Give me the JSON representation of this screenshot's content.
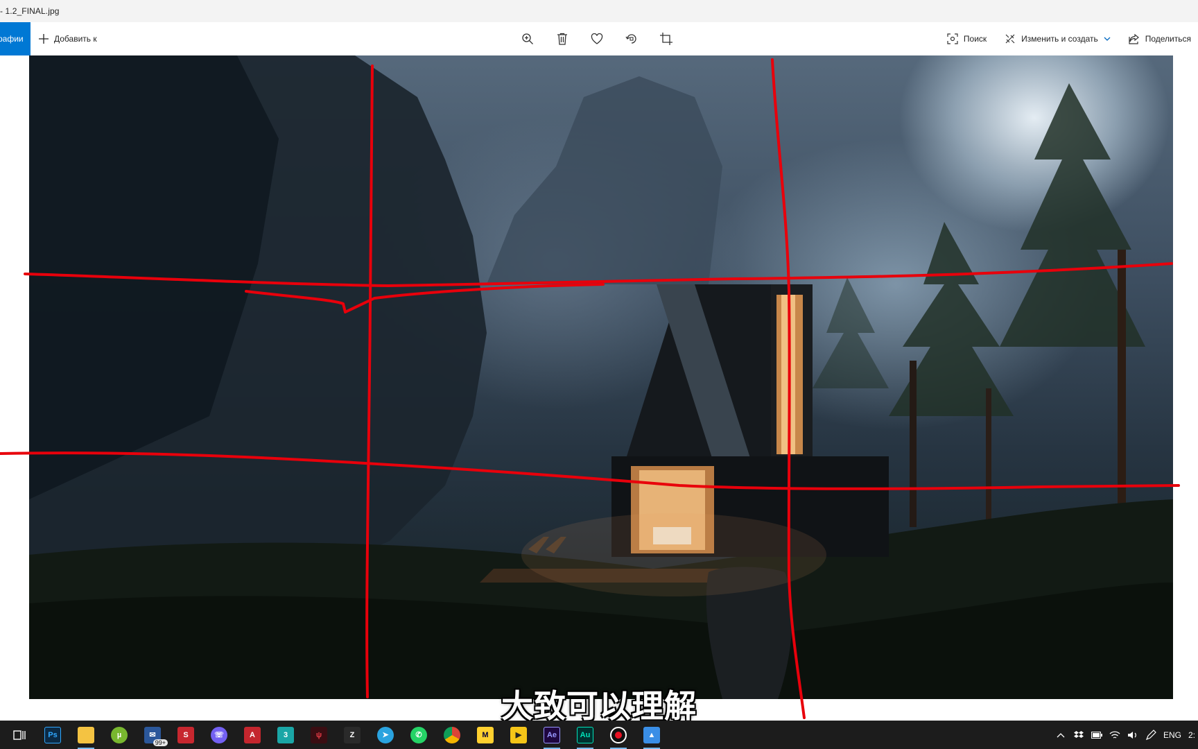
{
  "window": {
    "title": "- 1.2_FINAL.jpg"
  },
  "toolbar": {
    "tab_label": "рафии",
    "add_label": "Добавить к",
    "search_label": "Поиск",
    "edit_label": "Изменить и создать",
    "share_label": "Поделиться"
  },
  "subtitle": "大致可以理解",
  "taskbar": {
    "mail_badge": "99+",
    "lang": "ENG",
    "clock_partial": "2:"
  },
  "icons": {
    "toolbar": [
      "plus-icon",
      "zoom-in-icon",
      "delete-icon",
      "favorite-icon",
      "rotate-icon",
      "crop-icon",
      "search-icon",
      "edit-create-icon",
      "chevron-down-icon",
      "share-icon"
    ],
    "taskbar": [
      "task-view-icon",
      "photoshop-icon",
      "file-explorer-icon",
      "utorrent-icon",
      "mail-icon",
      "sketchup-icon",
      "viber-icon",
      "autocad-icon",
      "3dsmax-icon",
      "predator-icon",
      "zbrush-icon",
      "telegram-icon",
      "whatsapp-icon",
      "chrome-icon",
      "miro-icon",
      "media-player-icon",
      "after-effects-icon",
      "audition-icon",
      "recorder-icon",
      "photos-icon"
    ]
  },
  "colors": {
    "accent": "#0078d4",
    "annotation": "#e8000b",
    "taskbar": "#1c1c1c"
  }
}
